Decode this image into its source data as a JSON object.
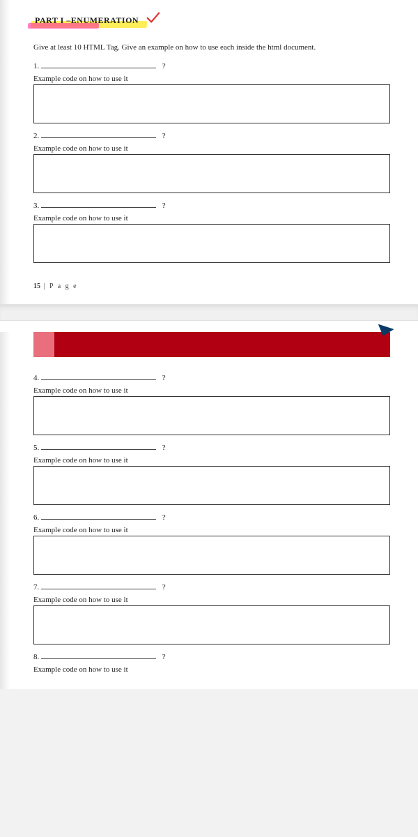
{
  "doc_title": "PART I –ENUMERATION",
  "instruction": "Give at least 10 HTML Tag.  Give an example on how to use each inside the html document.",
  "example_label": "Example code on how to use it",
  "question_mark": "?",
  "items_page1": [
    {
      "num": "1."
    },
    {
      "num": "2."
    },
    {
      "num": "3."
    }
  ],
  "items_page2": [
    {
      "num": "4."
    },
    {
      "num": "5."
    },
    {
      "num": "6."
    },
    {
      "num": "7."
    },
    {
      "num": "8."
    }
  ],
  "page_number_prefix": "15",
  "page_number_suffix": " | P a g e"
}
